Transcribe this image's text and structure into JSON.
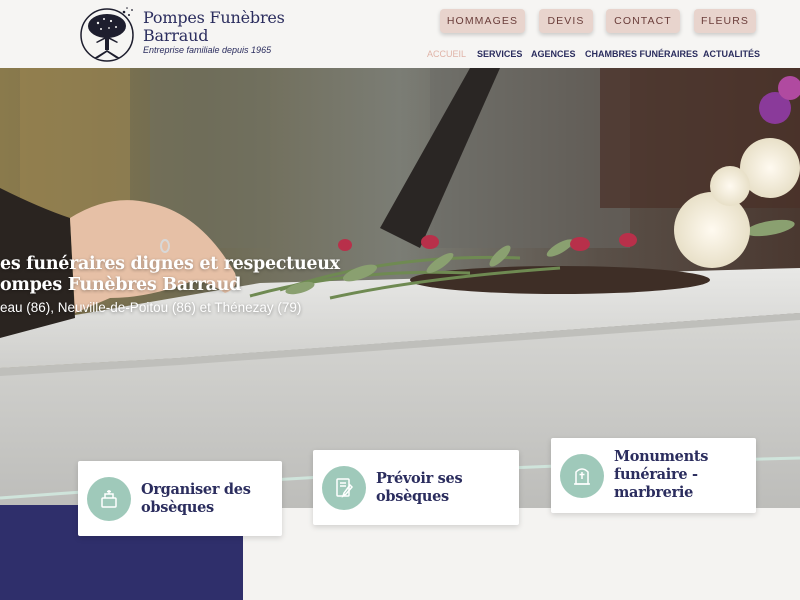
{
  "logo": {
    "name": "Pompes Funèbres Barraud",
    "name_line1": "Pompes Funèbres",
    "name_line2": "Barraud",
    "tagline": "Entreprise familiale depuis 1965"
  },
  "top_buttons": [
    "HOMMAGES",
    "DEVIS",
    "CONTACT",
    "FLEURS"
  ],
  "nav": {
    "items": [
      "ACCUEIL",
      "SERVICES",
      "AGENCES",
      "CHAMBRES FUNÉRAIRES",
      "ACTUALITÉS"
    ],
    "active": "ACCUEIL"
  },
  "hero": {
    "line1": "es funéraires dignes et respectueux",
    "line2": "ompes Funèbres Barraud",
    "line3": "eau (86), Neuville-de-Poitou (86) et Thénezay (79)"
  },
  "cards": [
    {
      "title": "Organiser des obsèques",
      "icon": "funeral-urn-icon"
    },
    {
      "title": "Prévoir ses obsèques",
      "icon": "contract-pen-icon"
    },
    {
      "title": "Monuments funéraire - marbrerie",
      "icon": "tombstone-icon"
    }
  ],
  "colors": {
    "navy": "#2f2f6b",
    "brand_text": "#2b2d5e",
    "button_bg": "#e8d4cd",
    "button_text": "#6a3d3a",
    "nav_active": "#e0b4a8",
    "mint": "#9fc9ba"
  }
}
